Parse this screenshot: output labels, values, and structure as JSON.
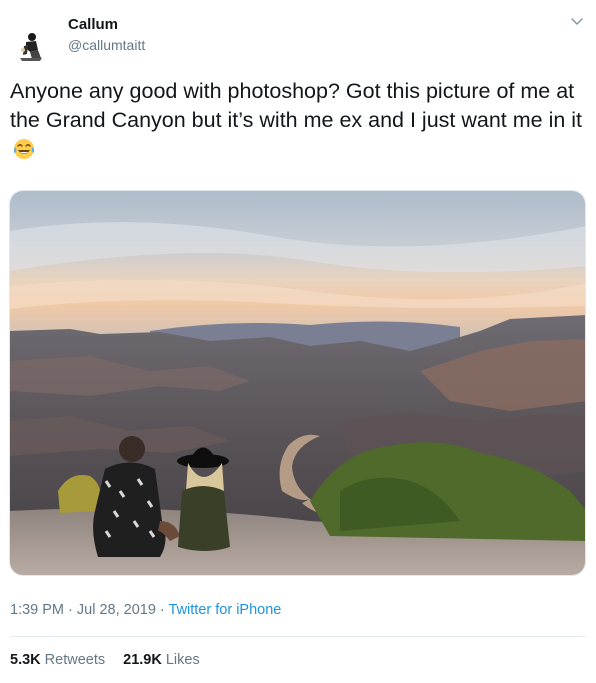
{
  "user": {
    "name": "Callum",
    "handle": "@callumtaitt"
  },
  "tweet": {
    "text": "Anyone any good with photoshop? Got this picture of me at the Grand Canyon but it’s with me ex and I just want me in it",
    "emoji": "face-with-tears-of-joy"
  },
  "meta": {
    "time": "1:39 PM",
    "separator1": " · ",
    "date": "Jul 28, 2019",
    "separator2": " · ",
    "source": "Twitter for iPhone"
  },
  "stats": {
    "retweets_count": "5.3K",
    "retweets_label": " Retweets",
    "likes_count": "21.9K",
    "likes_label": " Likes"
  },
  "colors": {
    "link": "#1b95e0",
    "secondary_text": "#657786",
    "divider": "#e6ecf0"
  }
}
